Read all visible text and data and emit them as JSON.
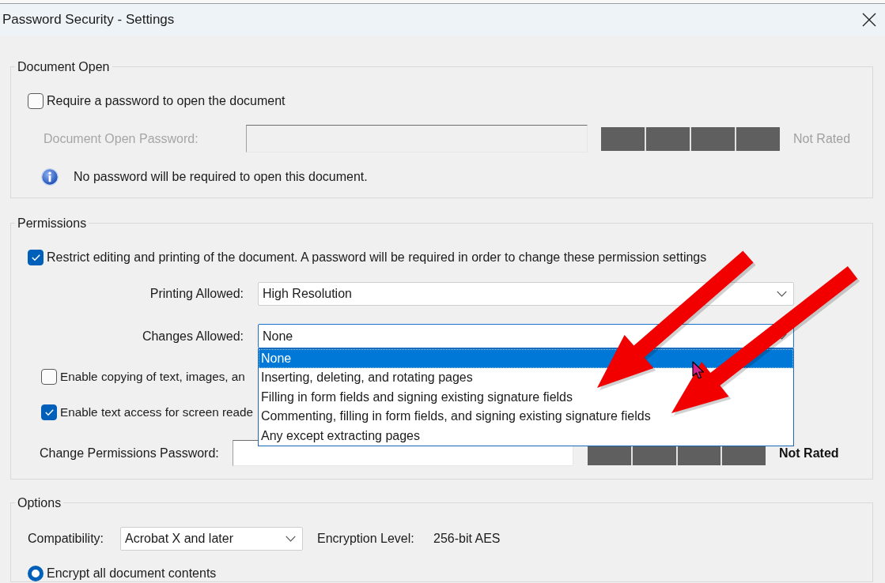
{
  "window": {
    "title": "Password Security - Settings"
  },
  "document_open": {
    "title": "Document Open",
    "require_password": {
      "label": "Require a password to open the document",
      "checked": false
    },
    "password": {
      "label": "Document Open Password:",
      "disabled": true,
      "rating": "Not Rated"
    },
    "info": "No password will be required to open this document."
  },
  "permissions": {
    "title": "Permissions",
    "restrict": {
      "label": "Restrict editing and printing of the document. A password will be required in order to change these permission settings",
      "checked": true
    },
    "printing": {
      "label": "Printing Allowed:",
      "value": "High Resolution",
      "expanded": false
    },
    "changes": {
      "label": "Changes Allowed:",
      "value": "None",
      "expanded": true,
      "options": [
        {
          "label": "None",
          "selected": true
        },
        {
          "label": "Inserting, deleting, and rotating pages",
          "selected": false
        },
        {
          "label": "Filling in form fields and signing existing signature fields",
          "selected": false
        },
        {
          "label": "Commenting, filling in form fields, and signing existing signature fields",
          "selected": false
        },
        {
          "label": "Any except extracting pages",
          "selected": false
        }
      ]
    },
    "checkboxes": [
      {
        "label": "Enable copying of text, images, an",
        "checked": false
      },
      {
        "label": "Enable text access for screen reade",
        "checked": true
      }
    ],
    "password": {
      "label": "Change Permissions Password:",
      "disabled": false,
      "rating": "Not Rated"
    }
  },
  "options": {
    "title": "Options",
    "compatibility": {
      "label": "Compatibility:",
      "value": "Acrobat X and later"
    },
    "encryption": {
      "label": "Encryption Level:",
      "value": "256-bit AES"
    },
    "radios": [
      {
        "label": "Encrypt all document contents",
        "selected": true
      }
    ]
  },
  "annotations": [
    {
      "kind": "arrow"
    },
    {
      "kind": "arrow"
    },
    {
      "kind": "cursor"
    }
  ]
}
